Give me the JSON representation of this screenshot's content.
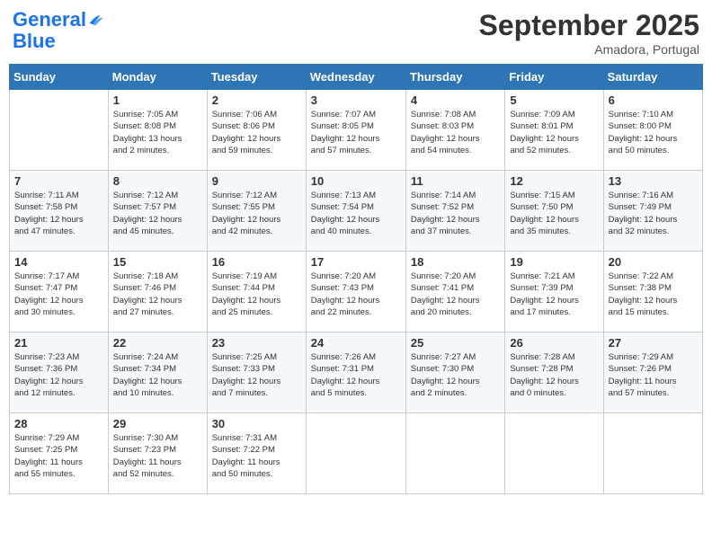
{
  "header": {
    "logo_line1": "General",
    "logo_line2": "Blue",
    "month": "September 2025",
    "location": "Amadora, Portugal"
  },
  "days_of_week": [
    "Sunday",
    "Monday",
    "Tuesday",
    "Wednesday",
    "Thursday",
    "Friday",
    "Saturday"
  ],
  "weeks": [
    [
      {
        "day": "",
        "info": ""
      },
      {
        "day": "1",
        "info": "Sunrise: 7:05 AM\nSunset: 8:08 PM\nDaylight: 13 hours\nand 2 minutes."
      },
      {
        "day": "2",
        "info": "Sunrise: 7:06 AM\nSunset: 8:06 PM\nDaylight: 12 hours\nand 59 minutes."
      },
      {
        "day": "3",
        "info": "Sunrise: 7:07 AM\nSunset: 8:05 PM\nDaylight: 12 hours\nand 57 minutes."
      },
      {
        "day": "4",
        "info": "Sunrise: 7:08 AM\nSunset: 8:03 PM\nDaylight: 12 hours\nand 54 minutes."
      },
      {
        "day": "5",
        "info": "Sunrise: 7:09 AM\nSunset: 8:01 PM\nDaylight: 12 hours\nand 52 minutes."
      },
      {
        "day": "6",
        "info": "Sunrise: 7:10 AM\nSunset: 8:00 PM\nDaylight: 12 hours\nand 50 minutes."
      }
    ],
    [
      {
        "day": "7",
        "info": "Sunrise: 7:11 AM\nSunset: 7:58 PM\nDaylight: 12 hours\nand 47 minutes."
      },
      {
        "day": "8",
        "info": "Sunrise: 7:12 AM\nSunset: 7:57 PM\nDaylight: 12 hours\nand 45 minutes."
      },
      {
        "day": "9",
        "info": "Sunrise: 7:12 AM\nSunset: 7:55 PM\nDaylight: 12 hours\nand 42 minutes."
      },
      {
        "day": "10",
        "info": "Sunrise: 7:13 AM\nSunset: 7:54 PM\nDaylight: 12 hours\nand 40 minutes."
      },
      {
        "day": "11",
        "info": "Sunrise: 7:14 AM\nSunset: 7:52 PM\nDaylight: 12 hours\nand 37 minutes."
      },
      {
        "day": "12",
        "info": "Sunrise: 7:15 AM\nSunset: 7:50 PM\nDaylight: 12 hours\nand 35 minutes."
      },
      {
        "day": "13",
        "info": "Sunrise: 7:16 AM\nSunset: 7:49 PM\nDaylight: 12 hours\nand 32 minutes."
      }
    ],
    [
      {
        "day": "14",
        "info": "Sunrise: 7:17 AM\nSunset: 7:47 PM\nDaylight: 12 hours\nand 30 minutes."
      },
      {
        "day": "15",
        "info": "Sunrise: 7:18 AM\nSunset: 7:46 PM\nDaylight: 12 hours\nand 27 minutes."
      },
      {
        "day": "16",
        "info": "Sunrise: 7:19 AM\nSunset: 7:44 PM\nDaylight: 12 hours\nand 25 minutes."
      },
      {
        "day": "17",
        "info": "Sunrise: 7:20 AM\nSunset: 7:43 PM\nDaylight: 12 hours\nand 22 minutes."
      },
      {
        "day": "18",
        "info": "Sunrise: 7:20 AM\nSunset: 7:41 PM\nDaylight: 12 hours\nand 20 minutes."
      },
      {
        "day": "19",
        "info": "Sunrise: 7:21 AM\nSunset: 7:39 PM\nDaylight: 12 hours\nand 17 minutes."
      },
      {
        "day": "20",
        "info": "Sunrise: 7:22 AM\nSunset: 7:38 PM\nDaylight: 12 hours\nand 15 minutes."
      }
    ],
    [
      {
        "day": "21",
        "info": "Sunrise: 7:23 AM\nSunset: 7:36 PM\nDaylight: 12 hours\nand 12 minutes."
      },
      {
        "day": "22",
        "info": "Sunrise: 7:24 AM\nSunset: 7:34 PM\nDaylight: 12 hours\nand 10 minutes."
      },
      {
        "day": "23",
        "info": "Sunrise: 7:25 AM\nSunset: 7:33 PM\nDaylight: 12 hours\nand 7 minutes."
      },
      {
        "day": "24",
        "info": "Sunrise: 7:26 AM\nSunset: 7:31 PM\nDaylight: 12 hours\nand 5 minutes."
      },
      {
        "day": "25",
        "info": "Sunrise: 7:27 AM\nSunset: 7:30 PM\nDaylight: 12 hours\nand 2 minutes."
      },
      {
        "day": "26",
        "info": "Sunrise: 7:28 AM\nSunset: 7:28 PM\nDaylight: 12 hours\nand 0 minutes."
      },
      {
        "day": "27",
        "info": "Sunrise: 7:29 AM\nSunset: 7:26 PM\nDaylight: 11 hours\nand 57 minutes."
      }
    ],
    [
      {
        "day": "28",
        "info": "Sunrise: 7:29 AM\nSunset: 7:25 PM\nDaylight: 11 hours\nand 55 minutes."
      },
      {
        "day": "29",
        "info": "Sunrise: 7:30 AM\nSunset: 7:23 PM\nDaylight: 11 hours\nand 52 minutes."
      },
      {
        "day": "30",
        "info": "Sunrise: 7:31 AM\nSunset: 7:22 PM\nDaylight: 11 hours\nand 50 minutes."
      },
      {
        "day": "",
        "info": ""
      },
      {
        "day": "",
        "info": ""
      },
      {
        "day": "",
        "info": ""
      },
      {
        "day": "",
        "info": ""
      }
    ]
  ]
}
